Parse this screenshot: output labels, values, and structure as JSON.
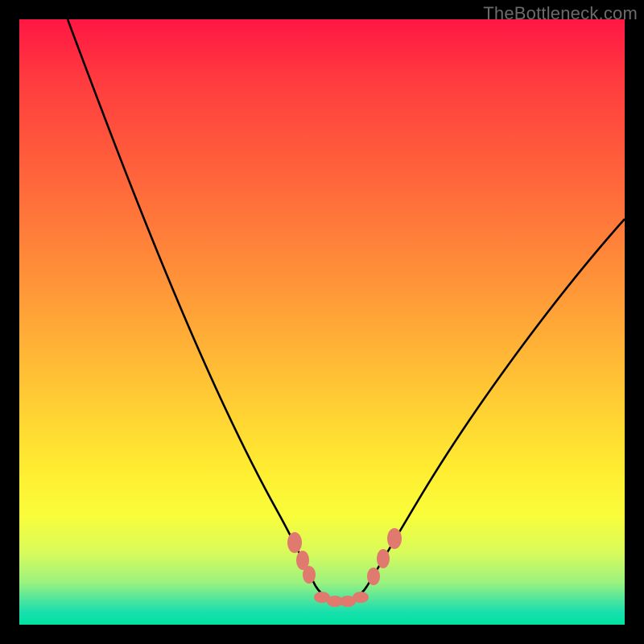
{
  "watermark": "TheBottleneck.com",
  "chart_data": {
    "type": "line",
    "title": "",
    "xlabel": "",
    "ylabel": "",
    "xlim": [
      0,
      100
    ],
    "ylim": [
      0,
      100
    ],
    "background": "rainbow-vertical-gradient",
    "series": [
      {
        "name": "bottleneck-curve",
        "x": [
          8,
          12,
          16,
          20,
          24,
          28,
          32,
          36,
          40,
          43,
          45,
          47,
          49,
          51,
          53,
          55,
          57,
          60,
          64,
          68,
          72,
          76,
          80,
          84,
          88,
          92,
          96,
          100
        ],
        "y": [
          100,
          90,
          80,
          70,
          60,
          50,
          41,
          32,
          24,
          17,
          12,
          8,
          5,
          3,
          3,
          5,
          8,
          13,
          20,
          27,
          33,
          39,
          45,
          51,
          57,
          62,
          67,
          72
        ]
      }
    ],
    "markers": {
      "name": "highlighted-points",
      "color": "#e07a6f",
      "points": [
        {
          "x": 43,
          "y": 17
        },
        {
          "x": 45,
          "y": 12
        },
        {
          "x": 46,
          "y": 9
        },
        {
          "x": 56,
          "y": 9
        },
        {
          "x": 58,
          "y": 13
        },
        {
          "x": 60,
          "y": 17
        }
      ],
      "flat_segment": {
        "x_start": 47,
        "x_end": 55,
        "y": 4
      }
    }
  }
}
